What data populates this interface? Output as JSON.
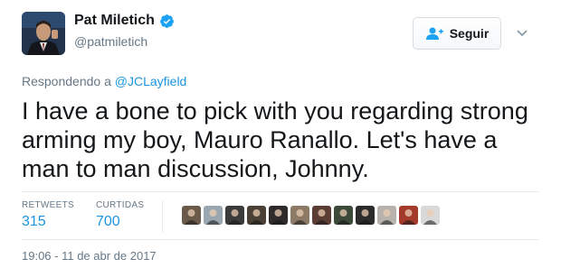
{
  "author": {
    "display_name": "Pat Miletich",
    "handle": "@patmiletich",
    "verified": true,
    "avatar_icon": "profile-photo-man-in-suit-icon"
  },
  "follow_button": {
    "label": "Seguir",
    "icon": "add-user-icon"
  },
  "menu": {
    "icon": "chevron-down-icon"
  },
  "reply_context": {
    "prefix": "Respondendo a ",
    "mention": "@JCLayfield"
  },
  "tweet": {
    "text": "I have a bone to pick with you regarding strong arming my boy, Mauro Ranallo. Let's have a man to man discussion, Johnny."
  },
  "stats": {
    "retweets_label": "RETWEETS",
    "retweets_count": "315",
    "likes_label": "CURTIDAS",
    "likes_count": "700"
  },
  "likers": [
    {
      "icon": "liker-avatar-icon",
      "color": "#6b5a4a"
    },
    {
      "icon": "liker-avatar-icon",
      "color": "#9aa7b0"
    },
    {
      "icon": "liker-avatar-icon",
      "color": "#3b3b3b"
    },
    {
      "icon": "liker-avatar-icon",
      "color": "#4a4036"
    },
    {
      "icon": "liker-avatar-icon",
      "color": "#2e2a2a"
    },
    {
      "icon": "liker-avatar-icon",
      "color": "#8c7a66"
    },
    {
      "icon": "liker-avatar-icon",
      "color": "#5c3d33"
    },
    {
      "icon": "liker-avatar-icon",
      "color": "#3c4a3a"
    },
    {
      "icon": "liker-avatar-icon",
      "color": "#2b2b2b"
    },
    {
      "icon": "liker-avatar-icon",
      "color": "#b7b2ac"
    },
    {
      "icon": "liker-avatar-icon",
      "color": "#a33a2a"
    },
    {
      "icon": "liker-avatar-icon",
      "color": "#d9d9d9"
    }
  ],
  "timestamp": "19:06 - 11 de abr de 2017",
  "colors": {
    "link": "#1b95e0",
    "verified": "#1da1f2",
    "muted_text": "#657786",
    "primary_text": "#14171a"
  }
}
